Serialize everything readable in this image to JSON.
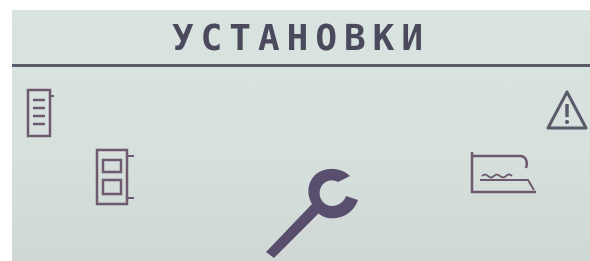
{
  "screen": {
    "title": "УСТАНОВКИ",
    "colors": {
      "background": "#d9e3df",
      "accent": "#6e5a6e",
      "selected": "#5a4e6e"
    },
    "menu_icons": [
      "document-list-icon",
      "boiler-icon",
      "wrench-icon",
      "tank-icon",
      "warning-icon"
    ],
    "selected_icon": "wrench-icon"
  }
}
